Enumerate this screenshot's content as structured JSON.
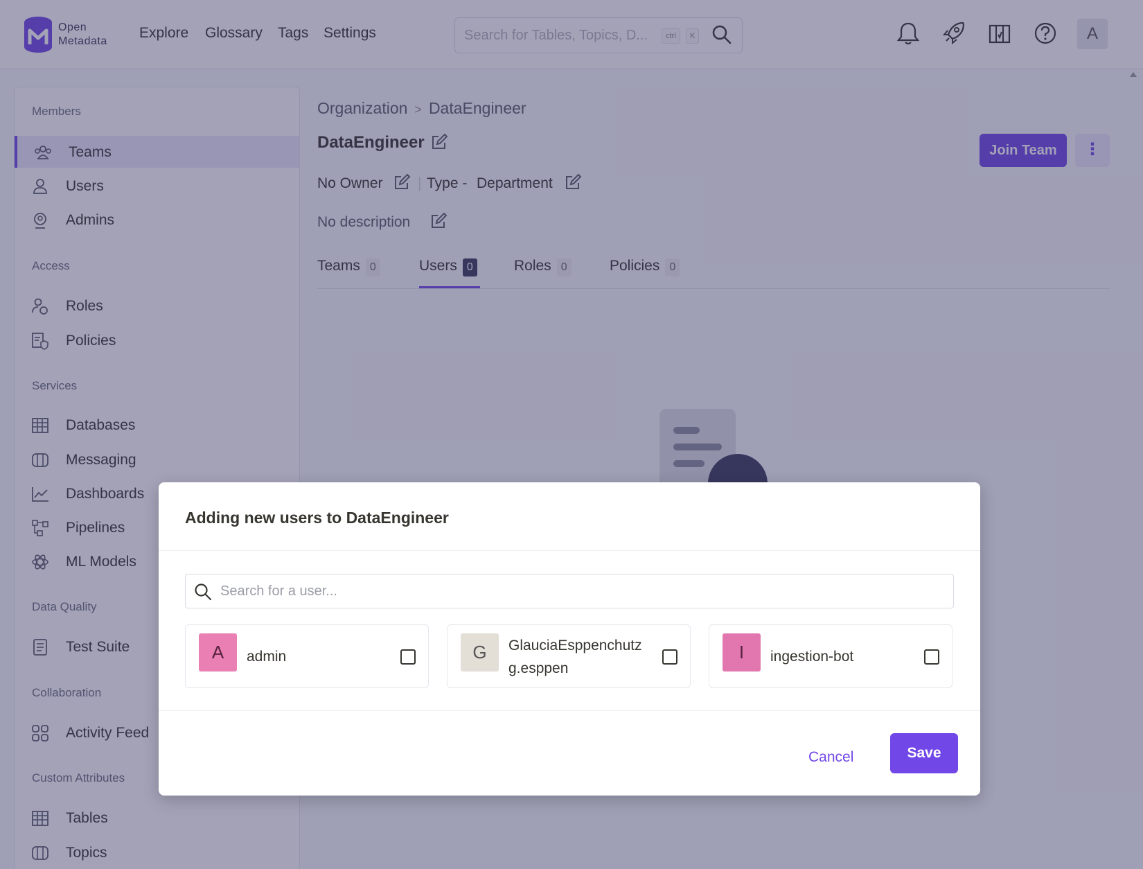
{
  "nav": {
    "logo_line1": "Open",
    "logo_line2": "Metadata",
    "links": [
      "Explore",
      "Glossary",
      "Tags",
      "Settings"
    ],
    "search_placeholder": "Search for Tables, Topics, D...",
    "kbd_ctrl": "ctrl",
    "kbd_k": "K",
    "avatar_letter": "A",
    "icons": [
      "bell-icon",
      "rocket-icon",
      "map-icon",
      "help-icon"
    ]
  },
  "sidebar": {
    "sections": [
      {
        "title": "Members",
        "items": [
          {
            "label": "Teams",
            "icon": "teams-icon",
            "active": true
          },
          {
            "label": "Users",
            "icon": "user-icon"
          },
          {
            "label": "Admins",
            "icon": "admin-icon"
          }
        ]
      },
      {
        "title": "Access",
        "items": [
          {
            "label": "Roles",
            "icon": "roles-icon"
          },
          {
            "label": "Policies",
            "icon": "policies-icon"
          }
        ]
      },
      {
        "title": "Services",
        "items": [
          {
            "label": "Databases",
            "icon": "table-icon"
          },
          {
            "label": "Messaging",
            "icon": "messaging-icon"
          },
          {
            "label": "Dashboards",
            "icon": "chart-icon"
          },
          {
            "label": "Pipelines",
            "icon": "pipeline-icon"
          },
          {
            "label": "ML Models",
            "icon": "ml-icon"
          }
        ]
      },
      {
        "title": "Data Quality",
        "items": [
          {
            "label": "Test Suite",
            "icon": "test-suite-icon"
          }
        ]
      },
      {
        "title": "Collaboration",
        "items": [
          {
            "label": "Activity Feed",
            "icon": "activity-icon"
          }
        ]
      },
      {
        "title": "Custom Attributes",
        "items": [
          {
            "label": "Tables",
            "icon": "table-icon"
          },
          {
            "label": "Topics",
            "icon": "messaging-icon"
          }
        ]
      }
    ]
  },
  "main": {
    "breadcrumb": [
      "Organization",
      "DataEngineer"
    ],
    "title": "DataEngineer",
    "owner": "No Owner",
    "type_label": "Type -",
    "type_value": "Department",
    "description": "No description",
    "join_button": "Join Team",
    "more_button": "⋮",
    "tabs": [
      {
        "label": "Teams",
        "count": "0"
      },
      {
        "label": "Users",
        "count": "0",
        "active": true
      },
      {
        "label": "Roles",
        "count": "0"
      },
      {
        "label": "Policies",
        "count": "0"
      }
    ]
  },
  "modal": {
    "title": "Adding new users to DataEngineer",
    "search_placeholder": "Search for a user...",
    "users": [
      {
        "initial": "A",
        "name": "admin",
        "sub": "",
        "color": "#e97fb3",
        "text_color": "#5a2340"
      },
      {
        "initial": "G",
        "name": "GlauciaEsppenchutz",
        "sub": "g.esppen",
        "color": "#e3ded6",
        "text_color": "#555555"
      },
      {
        "initial": "I",
        "name": "ingestion-bot",
        "sub": "",
        "color": "#e277b0",
        "text_color": "#5a2340"
      }
    ],
    "cancel_label": "Cancel",
    "save_label": "Save"
  },
  "colors": {
    "accent": "#7147e8",
    "dark": "#3b3b5c",
    "overlay": "rgba(52,48,95,0.45)"
  }
}
